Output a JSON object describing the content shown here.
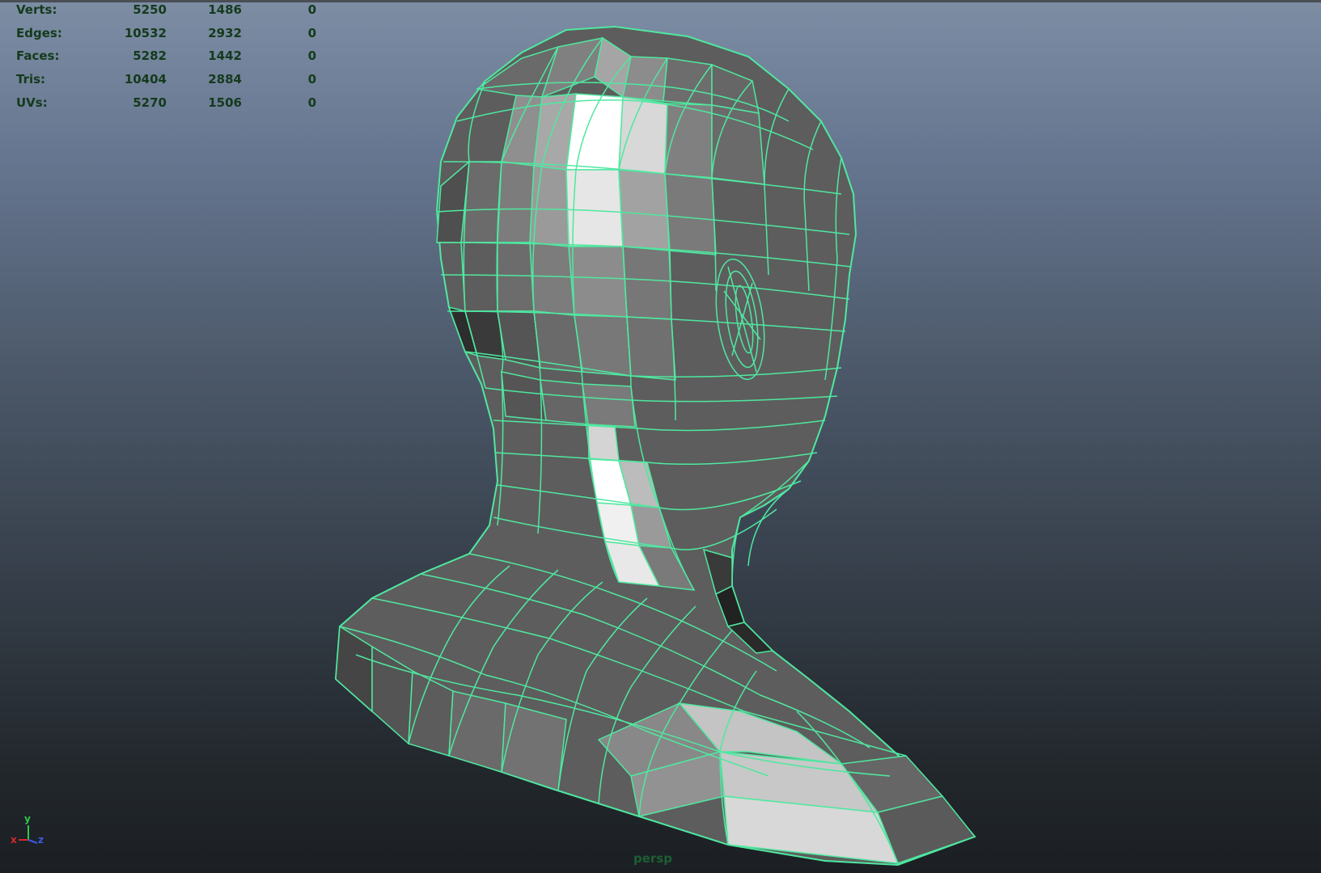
{
  "hud": {
    "rows": [
      {
        "label": "Verts:",
        "v1": "5250",
        "v2": "1486",
        "v3": "0"
      },
      {
        "label": "Edges:",
        "v1": "10532",
        "v2": "2932",
        "v3": "0"
      },
      {
        "label": "Faces:",
        "v1": "5282",
        "v2": "1442",
        "v3": "0"
      },
      {
        "label": "Tris:",
        "v1": "10404",
        "v2": "2884",
        "v3": "0"
      },
      {
        "label": "UVs:",
        "v1": "5270",
        "v2": "1506",
        "v3": "0"
      }
    ]
  },
  "camera": {
    "label": "persp"
  },
  "axis": {
    "x": "x",
    "y": "y",
    "z": "z"
  },
  "colors": {
    "wire": "#4fe8a0",
    "hud_text": "#143a1c",
    "axis_x": "#d42a2a",
    "axis_y": "#2ec84a",
    "axis_z": "#3a5ae0"
  }
}
